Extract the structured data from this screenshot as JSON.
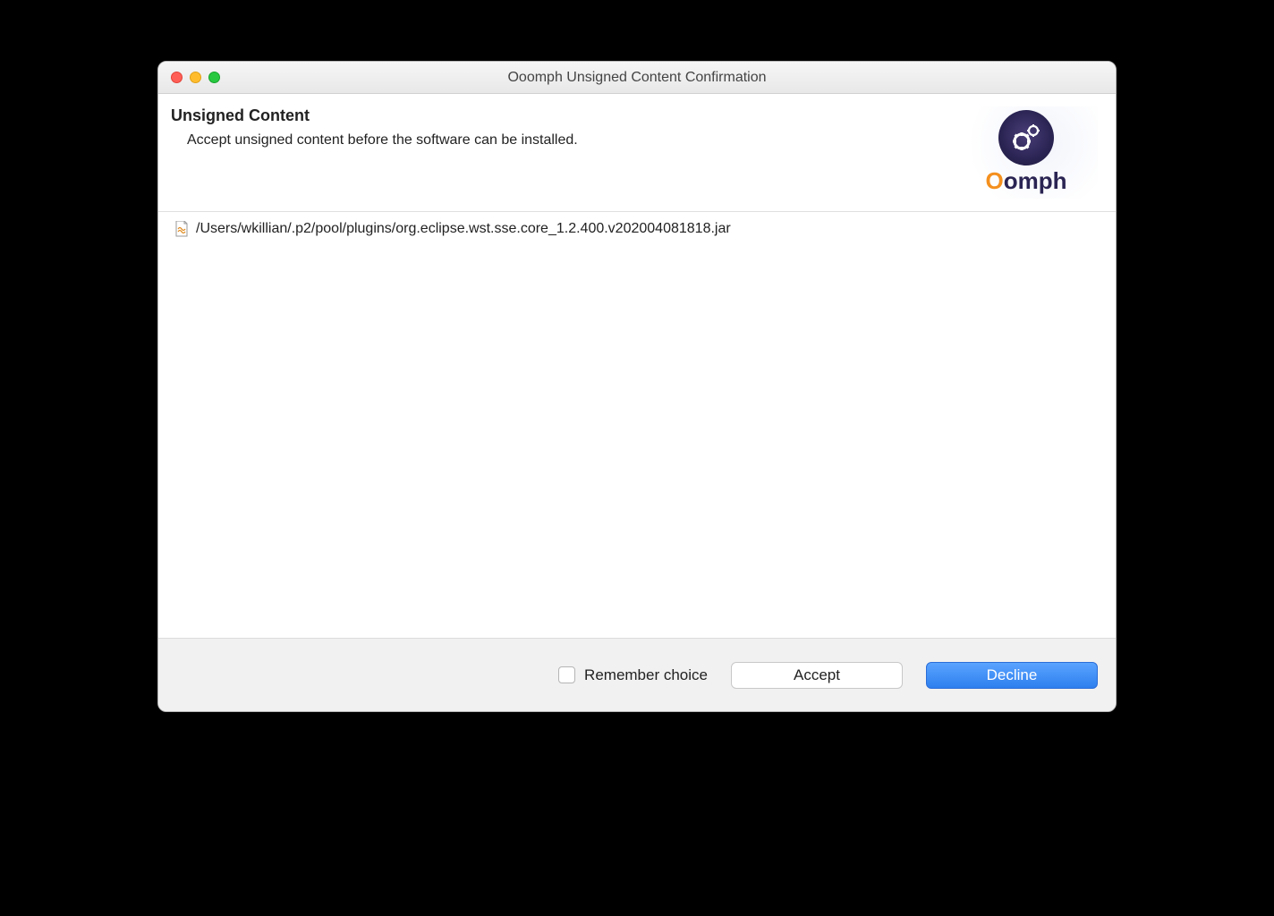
{
  "window": {
    "title": "Ooomph Unsigned Content Confirmation"
  },
  "header": {
    "title": "Unsigned Content",
    "subtitle": "Accept unsigned content before the software can be installed."
  },
  "logo": {
    "text_prefix": "O",
    "text_rest": "omph"
  },
  "content": {
    "items": [
      {
        "path": "/Users/wkillian/.p2/pool/plugins/org.eclipse.wst.sse.core_1.2.400.v202004081818.jar"
      }
    ]
  },
  "footer": {
    "remember_label": "Remember choice",
    "accept_label": "Accept",
    "decline_label": "Decline"
  }
}
